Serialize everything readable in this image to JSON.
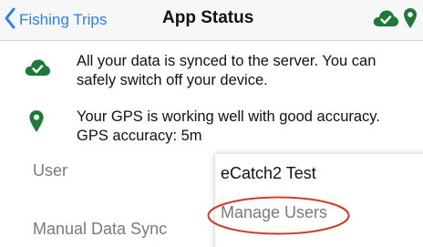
{
  "navbar": {
    "back_label": "Fishing Trips",
    "title": "App Status",
    "icons": [
      "cloud-check-icon",
      "location-pin-icon"
    ]
  },
  "status": {
    "sync_text": "All your data is synced to the server. You can safely switch off your device.",
    "gps_line1": "Your GPS is working well with good accuracy.",
    "gps_line2": "GPS accuracy: 5m"
  },
  "form": {
    "user_label": "User",
    "sync_label": "Manual Data Sync"
  },
  "dropdown": {
    "options": [
      "eCatch2 Test",
      "Manage Users"
    ]
  },
  "colors": {
    "accent": "#2a7ef6",
    "status_green": "#1f7a3a",
    "annotation_red": "#d23a2a"
  }
}
